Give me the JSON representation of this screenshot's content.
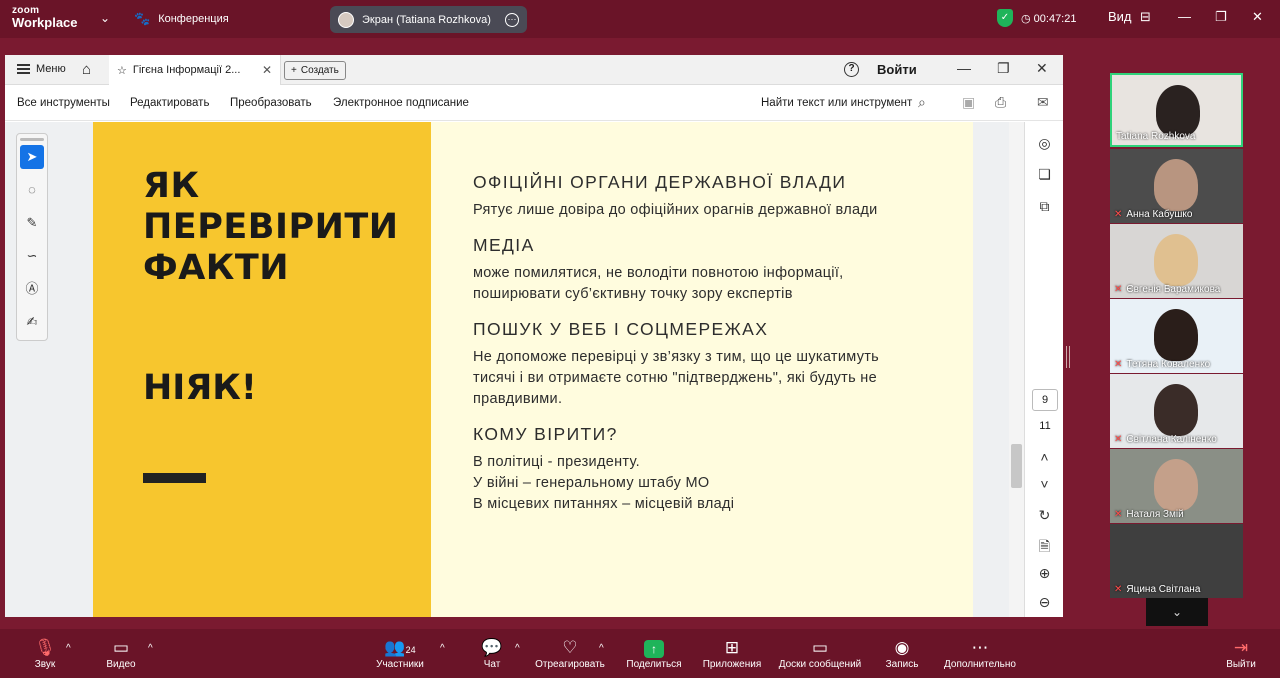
{
  "zoom_top": {
    "logo_line1": "zoom",
    "logo_line2": "Workplace",
    "meeting_label": "Конференция",
    "share_label": "Экран (Tatiana Rozhkova)",
    "timer": "00:47:21",
    "view_label": "Вид"
  },
  "acrobat": {
    "menu_label": "Меню",
    "tab_title": "Гігєна Інформації 2...",
    "create_label": "Создать",
    "login_label": "Войти",
    "tools": [
      "Все инструменты",
      "Редактировать",
      "Преобразовать",
      "Электронное подписание"
    ],
    "find_label": "Найти текст или инструмент",
    "page_current": "9",
    "page_total": "11"
  },
  "slide": {
    "title_lines": [
      "ЯК",
      "ПЕРЕВІРИТИ",
      "ФАКТИ"
    ],
    "answer": "НІЯК!",
    "sections": [
      {
        "heading": "ОФІЦІЙНІ ОРГАНИ ДЕРЖАВНОЇ ВЛАДИ",
        "lines": [
          "Рятує лише довіра до офіційних орагнів державної влади"
        ]
      },
      {
        "heading": "МЕДІА",
        "lines": [
          "може помилятися, не володіти повнотою інформації,",
          "поширювати суб’єктивну точку зору експертів"
        ]
      },
      {
        "heading": "ПОШУК У ВЕБ І СОЦМЕРЕЖАХ",
        "lines": [
          "Не допоможе перевірці у зв’язку з тим, що це шукатимуть",
          "тисячі і ви отримаєте сотню \"підтверджень\", які будуть не",
          "правдивими."
        ]
      },
      {
        "heading": "КОМУ ВІРИТИ?",
        "lines": [
          "В політиці - президенту.",
          "У війні – генеральному штабу МО",
          "В місцевих питаннях – місцевій владі"
        ]
      }
    ]
  },
  "participants": [
    {
      "name": "Tatiana Rozhkova",
      "muted": false
    },
    {
      "name": "Анна Кабушко",
      "muted": true
    },
    {
      "name": "Євгенія Барамикова",
      "muted": true
    },
    {
      "name": "Тетяна  Коваленко",
      "muted": true
    },
    {
      "name": "Світлана Каліненко",
      "muted": true
    },
    {
      "name": "Наталя Змій",
      "muted": true
    },
    {
      "name": "Яцина Світлана",
      "muted": true
    }
  ],
  "zoom_bottom": {
    "audio": "Звук",
    "video": "Видео",
    "participants": "Участники",
    "participants_count": "24",
    "chat": "Чат",
    "react": "Отреагировать",
    "share": "Поделиться",
    "apps": "Приложения",
    "whiteboards": "Доски сообщений",
    "record": "Запись",
    "more": "Дополнительно",
    "leave": "Выйти"
  },
  "colors": {
    "zoom_bg": "#7a1a30",
    "slide_yellow": "#f7c62e",
    "slide_cream": "#fffcde",
    "active_green": "#2fd27a"
  }
}
